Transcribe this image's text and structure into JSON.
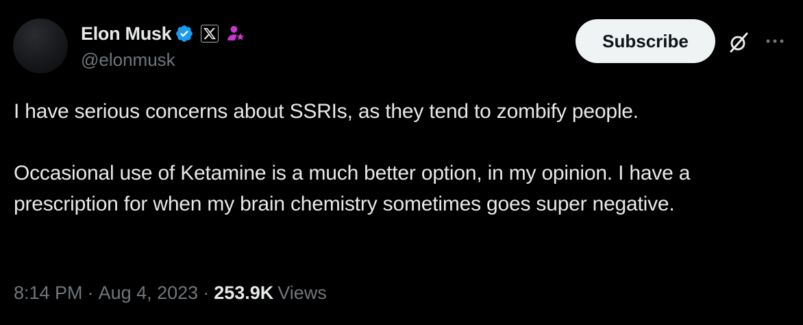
{
  "author": {
    "display_name": "Elon Musk",
    "handle": "@elonmusk",
    "verified_badge_color": "#1d9bf0",
    "affiliation_badge": "x-logo-icon",
    "extra_badge_color": "#c936cc"
  },
  "actions": {
    "subscribe_label": "Subscribe",
    "grok_icon": "grok-icon",
    "more_icon": "more-icon"
  },
  "tweet": {
    "paragraphs": [
      "I have serious concerns about SSRIs, as they tend to zombify people.",
      "Occasional use of Ketamine is a much better option, in my opinion. I have a prescription for when my brain chemistry sometimes goes super negative."
    ]
  },
  "meta": {
    "time": "8:14 PM",
    "separator": "·",
    "date": "Aug 4, 2023",
    "views_count": "253.9K",
    "views_label": "Views"
  },
  "colors": {
    "background": "#000000",
    "primary_text": "#e7e9ea",
    "secondary_text": "#71767b",
    "button_bg": "#eff3f4"
  }
}
